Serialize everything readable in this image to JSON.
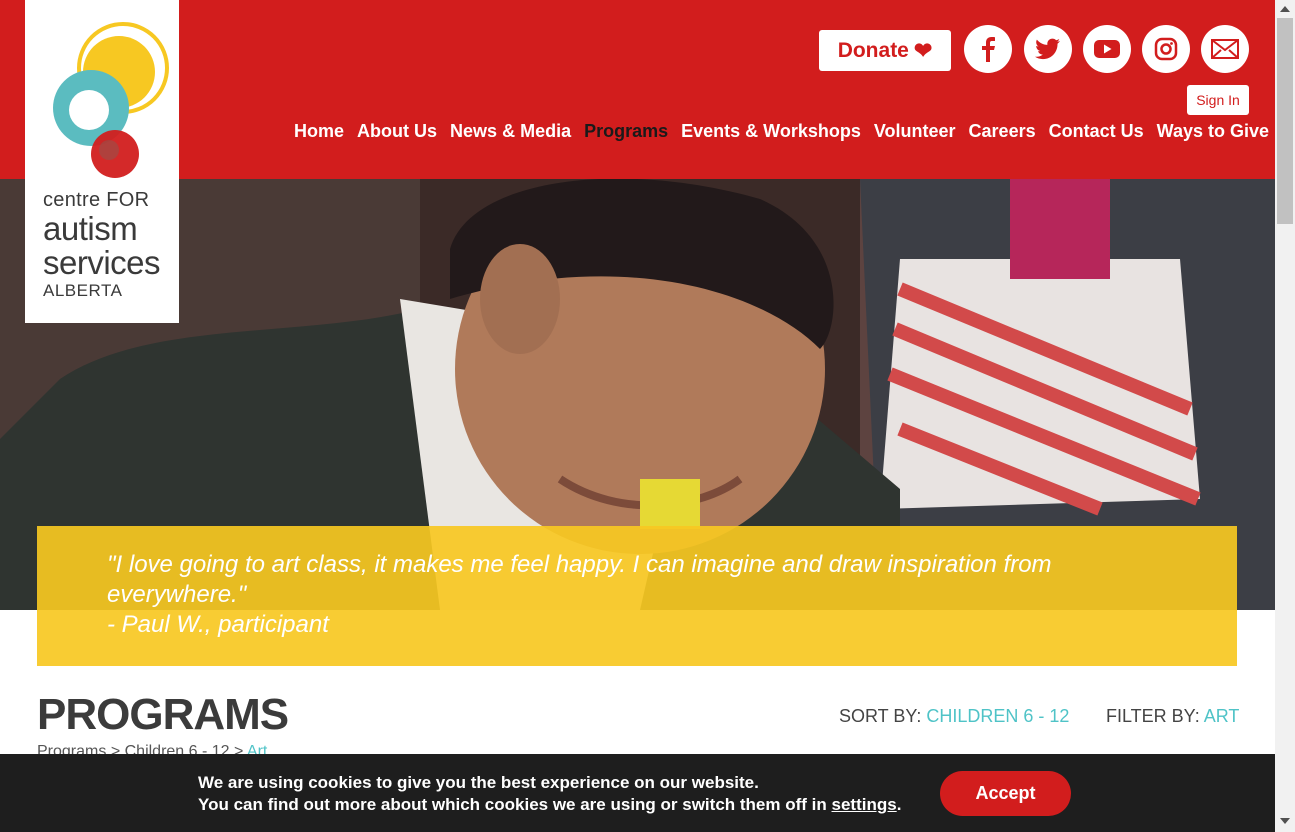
{
  "logo": {
    "line1": "centre FOR",
    "line2": "autism",
    "line3": "services",
    "line4": "ALBERTA"
  },
  "header": {
    "donate_label": "Donate",
    "signin_label": "Sign In",
    "social": [
      "facebook-icon",
      "twitter-icon",
      "youtube-icon",
      "instagram-icon",
      "email-icon"
    ]
  },
  "nav": {
    "items": [
      {
        "label": "Home"
      },
      {
        "label": "About Us"
      },
      {
        "label": "News & Media"
      },
      {
        "label": "Programs"
      },
      {
        "label": "Events & Workshops"
      },
      {
        "label": "Volunteer"
      },
      {
        "label": "Careers"
      },
      {
        "label": "Contact Us"
      },
      {
        "label": "Ways to Give"
      }
    ]
  },
  "hero": {
    "quote_line1": "\"I love going to art class, it makes me feel happy. I can imagine and draw inspiration from",
    "quote_line2": "everywhere.\"",
    "attribution": "- Paul W., participant"
  },
  "programs": {
    "title": "PROGRAMS",
    "sort_label": "SORT BY:",
    "sort_value": "CHILDREN 6 - 12",
    "filter_label": "FILTER BY:",
    "filter_value": "ART",
    "breadcrumb_1": "Programs",
    "breadcrumb_2": "Children 6 - 12",
    "breadcrumb_3": "Art"
  },
  "cookie": {
    "line1": "We are using cookies to give you the best experience on our website.",
    "line2_prefix": "You can find out more about which cookies we are using or switch them off in",
    "link": "settings",
    "line2_suffix": ".",
    "accept_label": "Accept"
  },
  "colors": {
    "brand_red": "#d21d1d",
    "accent_teal": "#4fc3c7",
    "quote_yellow": "#f7c822"
  }
}
